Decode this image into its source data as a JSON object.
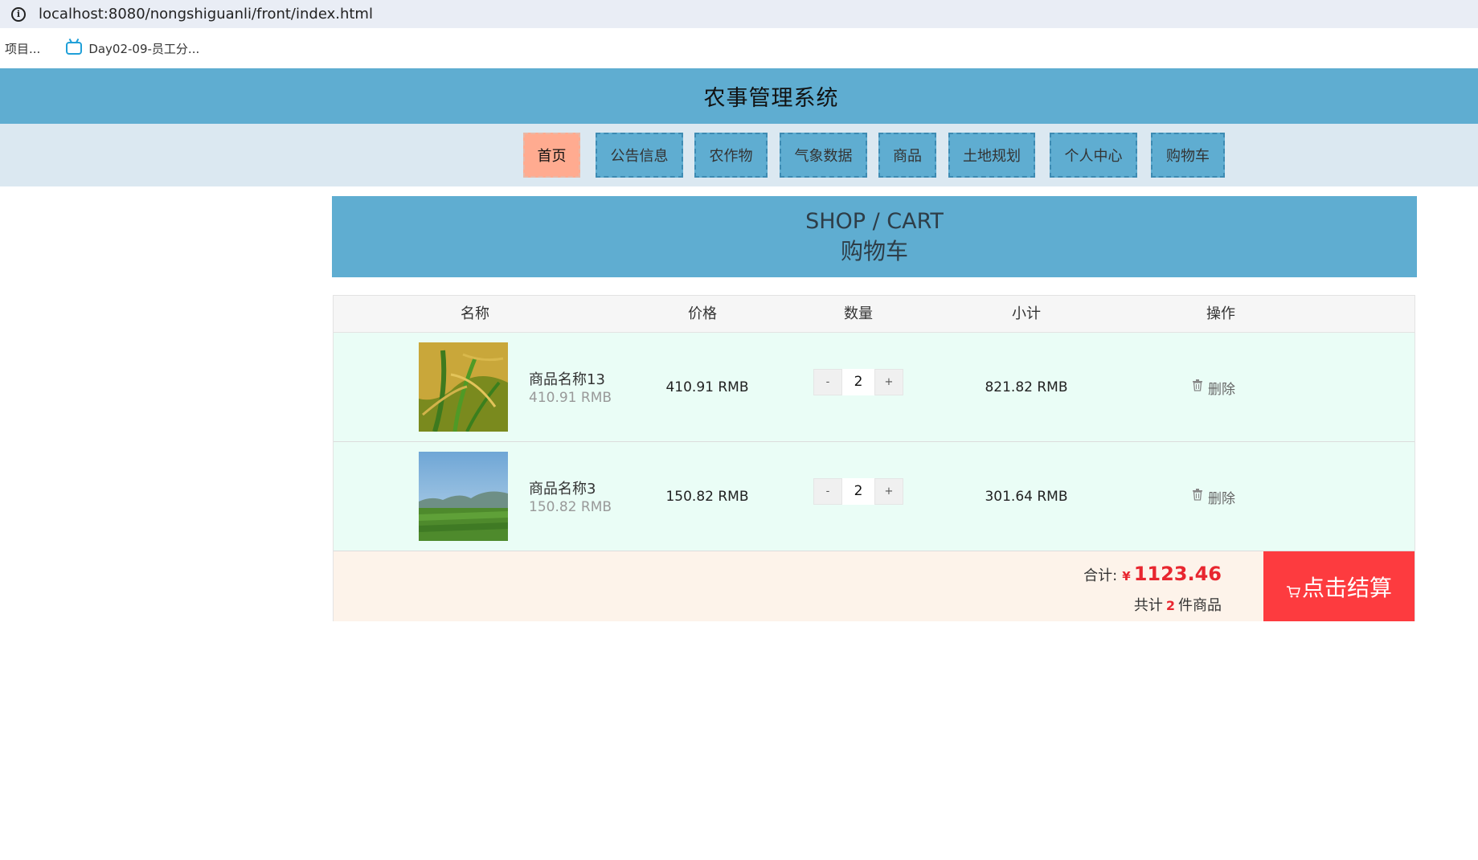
{
  "browser": {
    "url": "localhost:8080/nongshiguanli/front/index.html",
    "bookmarks": [
      {
        "label": "项目..."
      },
      {
        "label": "Day02-09-员工分...",
        "icon": "tv-icon"
      }
    ]
  },
  "site": {
    "title": "农事管理系统"
  },
  "nav": {
    "items": [
      {
        "label": "首页",
        "active": true
      },
      {
        "label": "公告信息"
      },
      {
        "label": "农作物"
      },
      {
        "label": "气象数据"
      },
      {
        "label": "商品"
      },
      {
        "label": "土地规划"
      },
      {
        "label": "个人中心"
      },
      {
        "label": "购物车"
      }
    ]
  },
  "banner": {
    "title_en": "SHOP / CART",
    "title_cn": "购物车"
  },
  "cart": {
    "columns": [
      "名称",
      "价格",
      "数量",
      "小计",
      "操作"
    ],
    "rows": [
      {
        "name": "商品名称13",
        "unit_price": "410.91 RMB",
        "price": "410.91 RMB",
        "qty": "2",
        "subtotal": "821.82 RMB",
        "image": "rice-field-closeup",
        "delete_label": "删除"
      },
      {
        "name": "商品名称3",
        "unit_price": "150.82 RMB",
        "price": "150.82 RMB",
        "qty": "2",
        "subtotal": "301.64 RMB",
        "image": "green-field-landscape",
        "delete_label": "删除"
      }
    ],
    "qty_minus": "-",
    "qty_plus": "+",
    "total_label": "合计:",
    "currency": "¥",
    "total": "1123.46",
    "count_prefix": "共计",
    "count": "2",
    "count_suffix": "件商品",
    "checkout_label": "点击结算"
  },
  "colors": {
    "header": "#5fadd1",
    "nav_bg": "#dbe8f1",
    "nav_active": "#ffab90",
    "row_bg": "#eafdf6",
    "footer_bg": "#fdf3ea",
    "accent_red": "#fd3b3f"
  }
}
